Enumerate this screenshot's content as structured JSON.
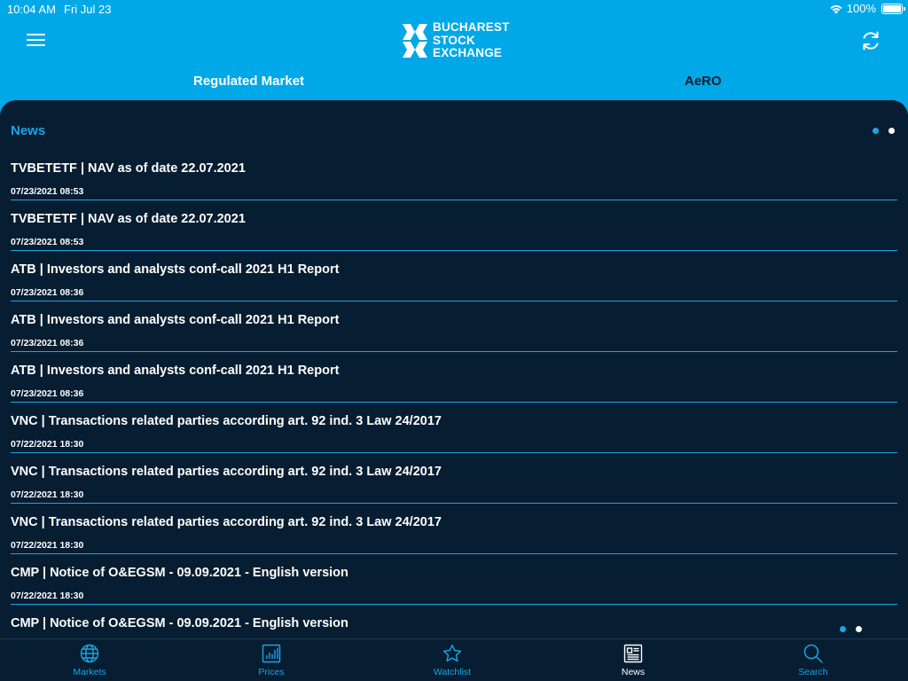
{
  "status_bar": {
    "time": "10:04 AM",
    "date": "Fri Jul 23",
    "battery": "100%",
    "battery_level": 1.0
  },
  "header": {
    "logo_lines": [
      "BUCHAREST",
      "STOCK",
      "EXCHANGE"
    ],
    "menu_icon": "hamburger-menu-icon",
    "refresh_icon": "refresh-icon"
  },
  "tabs": [
    {
      "label": "Regulated Market",
      "selected": true
    },
    {
      "label": "AeRO",
      "selected": false
    }
  ],
  "news": {
    "title": "News",
    "page_count": 2,
    "current_page": 1,
    "items": [
      {
        "title": "TVBETETF | NAV as of date 22.07.2021",
        "date": "07/23/2021 08:53"
      },
      {
        "title": "TVBETETF | NAV as of date 22.07.2021",
        "date": "07/23/2021 08:53"
      },
      {
        "title": "ATB | Investors and analysts conf-call 2021 H1 Report",
        "date": "07/23/2021 08:36"
      },
      {
        "title": "ATB | Investors and analysts conf-call 2021 H1 Report",
        "date": "07/23/2021 08:36"
      },
      {
        "title": "ATB | Investors and analysts conf-call 2021 H1 Report",
        "date": "07/23/2021 08:36"
      },
      {
        "title": "VNC | Transactions related parties according art. 92 ind. 3 Law 24/2017",
        "date": "07/22/2021 18:30"
      },
      {
        "title": "VNC | Transactions related parties according art. 92 ind. 3 Law 24/2017",
        "date": "07/22/2021 18:30"
      },
      {
        "title": "VNC | Transactions related parties according art. 92 ind. 3 Law 24/2017",
        "date": "07/22/2021 18:30"
      },
      {
        "title": "CMP | Notice of O&EGSM - 09.09.2021 - English version",
        "date": "07/22/2021 18:30"
      },
      {
        "title": "CMP | Notice of O&EGSM - 09.09.2021 - English version",
        "date": ""
      }
    ]
  },
  "tabbar": {
    "items": [
      {
        "label": "Markets",
        "icon": "globe-icon",
        "active": false
      },
      {
        "label": "Prices",
        "icon": "bar-chart-icon",
        "active": false
      },
      {
        "label": "Watchlist",
        "icon": "star-icon",
        "active": false
      },
      {
        "label": "News",
        "icon": "newspaper-icon",
        "active": true
      },
      {
        "label": "Search",
        "icon": "search-icon",
        "active": false
      }
    ]
  },
  "colors": {
    "brand_blue": "#00a8e8",
    "panel_bg": "#071d31",
    "accent": "#1aa6e4",
    "text": "#ffffff"
  }
}
